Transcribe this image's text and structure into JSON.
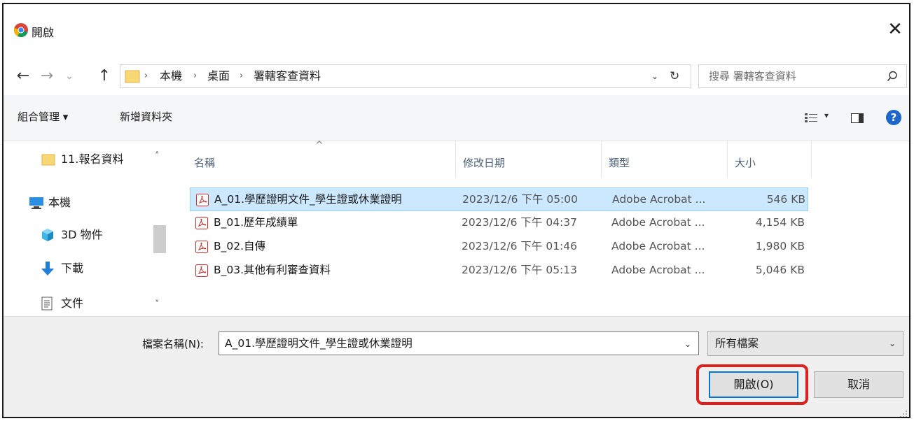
{
  "window": {
    "title": "開啟",
    "close_glyph": "✕"
  },
  "nav": {
    "back_glyph": "←",
    "forward_glyph": "→",
    "recent_glyph": "⌄",
    "up_glyph": "↑",
    "breadcrumb": [
      "本機",
      "桌面",
      "署轄客查資料"
    ],
    "breadcrumb_sep": "›",
    "address_dropdown_glyph": "⌄",
    "refresh_glyph": "↻",
    "search_placeholder": "搜尋 署轄客查資料"
  },
  "commands": {
    "organize": "組合管理 ▾",
    "new_folder": "新增資料夾",
    "view_drop": "▾",
    "help": "?"
  },
  "sidebar": {
    "items": [
      {
        "label": "11.報名資料",
        "icon": "folder-icon"
      },
      {
        "label": "本機",
        "icon": "computer-icon"
      },
      {
        "label": "3D 物件",
        "icon": "cube-icon"
      },
      {
        "label": "下載",
        "icon": "download-icon"
      },
      {
        "label": "文件",
        "icon": "document-icon"
      }
    ],
    "scroll_up": "˄",
    "scroll_down": "˅"
  },
  "columns": {
    "name": "名稱",
    "date": "修改日期",
    "type": "類型",
    "size": "大小",
    "sort_caret": "^"
  },
  "files": [
    {
      "name": "A_01.學歷證明文件_學生證或休業證明",
      "date": "2023/12/6 下午 05:00",
      "type": "Adobe Acrobat ...",
      "size": "546 KB",
      "selected": true
    },
    {
      "name": "B_01.歷年成績單",
      "date": "2023/12/6 下午 04:37",
      "type": "Adobe Acrobat ...",
      "size": "4,154 KB",
      "selected": false
    },
    {
      "name": "B_02.自傳",
      "date": "2023/12/6 下午 01:46",
      "type": "Adobe Acrobat ...",
      "size": "1,980 KB",
      "selected": false
    },
    {
      "name": "B_03.其他有利審查資料",
      "date": "2023/12/6 下午 05:13",
      "type": "Adobe Acrobat ...",
      "size": "5,046 KB",
      "selected": false
    }
  ],
  "footer": {
    "filename_label": "檔案名稱(N):",
    "filename_value": "A_01.學歷證明文件_學生證或休業證明",
    "filetype_value": "所有檔案",
    "dropdown_glyph": "⌄",
    "open_label": "開啟(O)",
    "cancel_label": "取消"
  },
  "colors": {
    "selection": "#cce8ff",
    "highlight": "#e0201c",
    "accent": "#0078d7",
    "pdf_red": "#d42b2b"
  }
}
